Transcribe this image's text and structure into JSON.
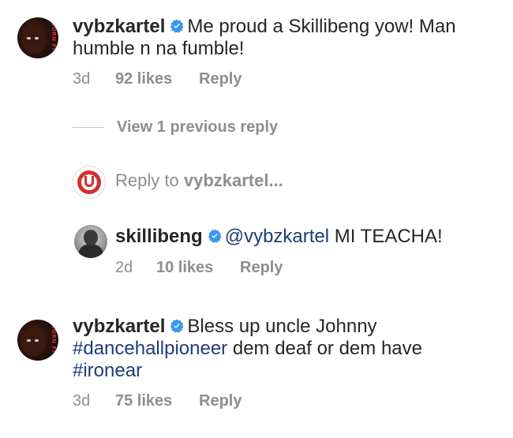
{
  "comments": [
    {
      "username": "vybzkartel",
      "text": "Me proud a Skillibeng yow! Man humble n na fumble!",
      "time": "3d",
      "likes": "92 likes",
      "reply_label": "Reply",
      "avatar_text": "BORN FI"
    },
    {
      "username": "vybzkartel",
      "text_before": "Bless up uncle Johnny",
      "hashtag1": "#dancehallpioneer",
      "text_middle": "dem deaf or dem have",
      "hashtag2": "#ironear",
      "time": "3d",
      "likes": "75 likes",
      "reply_label": "Reply",
      "avatar_text": "BORN FI"
    }
  ],
  "view_replies": "View 1 previous reply",
  "reply_input": {
    "prefix": "Reply to",
    "target": "vybzkartel..."
  },
  "reply": {
    "username": "skillibeng",
    "mention": "@vybzkartel",
    "text": "MI TEACHA!",
    "time": "2d",
    "likes": "10 likes",
    "reply_label": "Reply"
  },
  "colors": {
    "verified": "#3897f0",
    "link": "#1a3d7a",
    "meta": "#8e8e8e"
  }
}
